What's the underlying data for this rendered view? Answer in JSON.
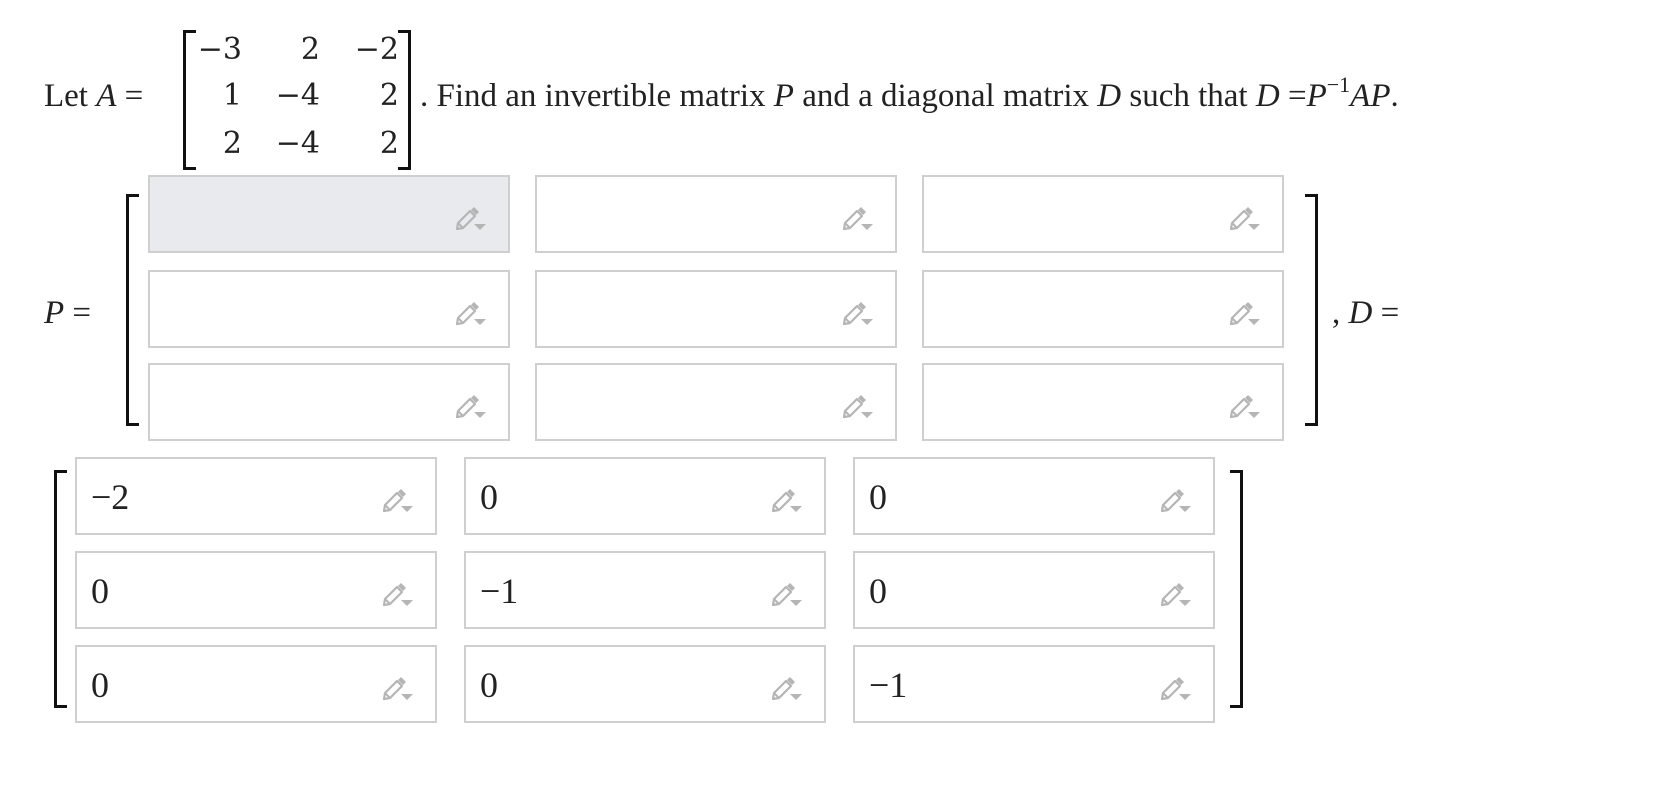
{
  "question": {
    "intro": "Let",
    "var_a": "A",
    "equals": "=",
    "matrix_a": [
      [
        "−3",
        "2",
        "−2"
      ],
      [
        "1",
        "−4",
        "2"
      ],
      [
        "2",
        "−4",
        "2"
      ]
    ],
    "after_matrix": ". Find an invertible matrix",
    "var_p": "P",
    "and_a_diagonal": "and a diagonal matrix",
    "var_d": "D",
    "such_that": "such that",
    "eq_lhs": "D",
    "eq_p": "P",
    "eq_exp": "−1",
    "eq_ap": "AP",
    "period": "."
  },
  "matrix_p": {
    "label": "P",
    "equals": "=",
    "cells": [
      [
        "",
        "",
        ""
      ],
      [
        "",
        "",
        ""
      ],
      [
        "",
        "",
        ""
      ]
    ],
    "active_cell": "r1c1"
  },
  "matrix_d": {
    "prefix": ",",
    "label": "D",
    "equals": "=",
    "cells": [
      [
        "−2",
        "0",
        "0"
      ],
      [
        "0",
        "−1",
        "0"
      ],
      [
        "0",
        "0",
        "−1"
      ]
    ]
  },
  "icons": {
    "edit": "pencil-dropdown-icon"
  },
  "colors": {
    "box_border": "#cfcfcf",
    "active_box_bg": "#e9eaee",
    "icon": "#b5b5b5"
  }
}
